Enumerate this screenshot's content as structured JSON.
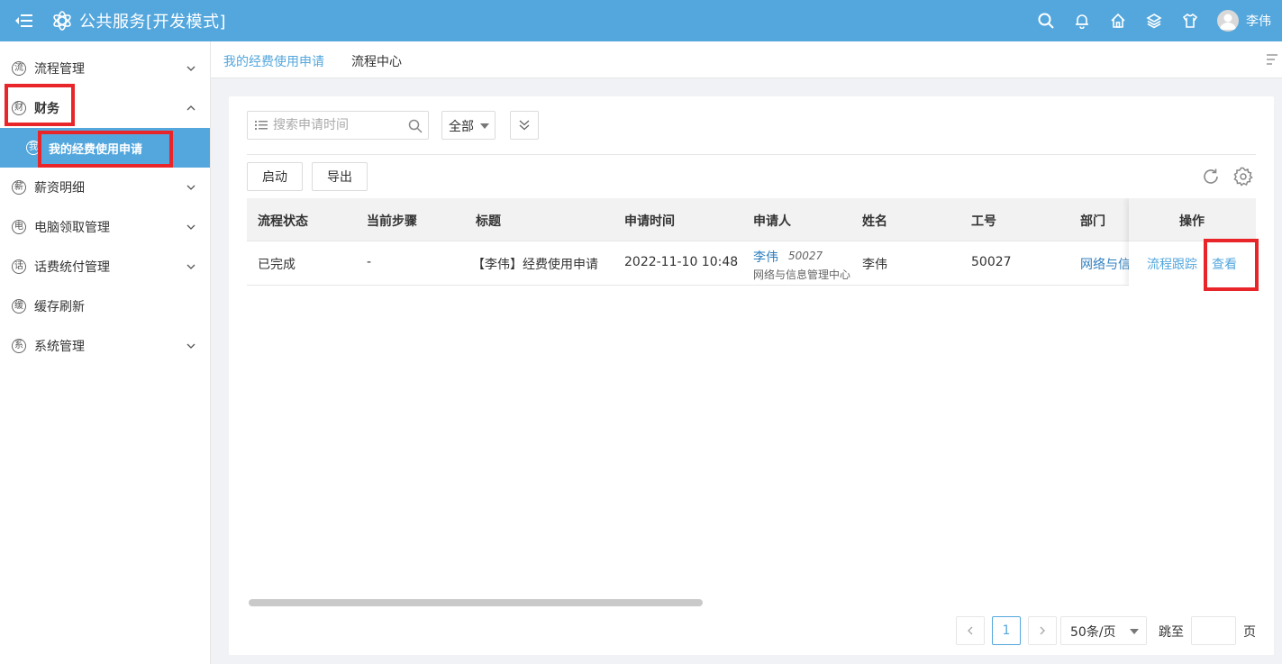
{
  "header": {
    "app_title": "公共服务[开发模式]",
    "username": "李伟",
    "icons": [
      "menu-toggle-icon",
      "logo-icon",
      "search-icon",
      "bell-icon",
      "home-icon",
      "layers-icon",
      "shirt-icon",
      "avatar"
    ]
  },
  "sidebar": {
    "items": [
      {
        "label": "流程管理",
        "icon_char": "流",
        "expanded": false
      },
      {
        "label": "财务",
        "icon_char": "财",
        "expanded": true
      },
      {
        "label": "我的经费使用申请",
        "icon_char": "我",
        "active": true
      },
      {
        "label": "薪资明细",
        "icon_char": "薪",
        "expanded": false
      },
      {
        "label": "电脑领取管理",
        "icon_char": "电",
        "expanded": false
      },
      {
        "label": "话费统付管理",
        "icon_char": "话",
        "expanded": false
      },
      {
        "label": "缓存刷新",
        "icon_char": "缓"
      },
      {
        "label": "系统管理",
        "icon_char": "系",
        "expanded": false
      }
    ]
  },
  "tabs": [
    {
      "label": "我的经费使用申请",
      "active": true
    },
    {
      "label": "流程中心",
      "active": false
    }
  ],
  "toolbar": {
    "search_placeholder": "搜索申请时间",
    "filter_value": "全部",
    "start_label": "启动",
    "export_label": "导出"
  },
  "table": {
    "columns": [
      "流程状态",
      "当前步骤",
      "标题",
      "申请时间",
      "申请人",
      "姓名",
      "工号",
      "部门",
      "操作"
    ],
    "rows": [
      {
        "status": "已完成",
        "step": "-",
        "title": "【李伟】经费使用申请",
        "apply_time": "2022-11-10 10:48",
        "applicant_name": "李伟",
        "applicant_id": "50027",
        "applicant_dept": "网络与信息管理中心",
        "name": "李伟",
        "emp_no": "50027",
        "dept": "网络与信",
        "action_track": "流程跟踪",
        "action_view": "查看"
      }
    ]
  },
  "pagination": {
    "current_page": "1",
    "page_size": "50条/页",
    "jump_label": "跳至",
    "page_label": "页"
  },
  "colors": {
    "primary": "#54a7dd",
    "highlight_box": "#e8262a"
  }
}
